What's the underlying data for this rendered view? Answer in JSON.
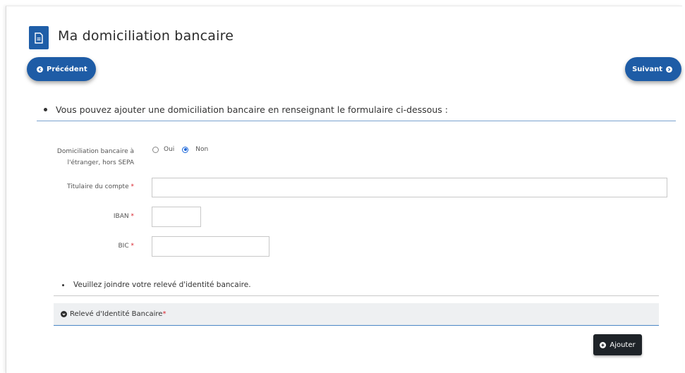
{
  "header": {
    "title": "Ma domiciliation bancaire",
    "icon": "document-icon"
  },
  "nav": {
    "prev_label": "Précédent",
    "next_label": "Suivant",
    "accent": "#1e5ca6"
  },
  "intro_text": "Vous pouvez ajouter une domiciliation bancaire en renseignant le formulaire ci-dessous :",
  "form": {
    "foreign_label_line1": "Domiciliation bancaire à",
    "foreign_label_line2": "l'étranger, hors SEPA",
    "radio_yes": "Oui",
    "radio_no": "Non",
    "selected": "Non",
    "holder_label": "Titulaire du compte",
    "holder_value": "",
    "iban_label": "IBAN",
    "iban_value": "",
    "bic_label": "BIC",
    "bic_value": "",
    "required_mark": "*"
  },
  "attachment": {
    "instruction": "Veuillez joindre votre relevé d'identité bancaire.",
    "panel_title": "Relevé d'Identité Bancaire",
    "required_mark": "*",
    "add_label": "Ajouter"
  }
}
